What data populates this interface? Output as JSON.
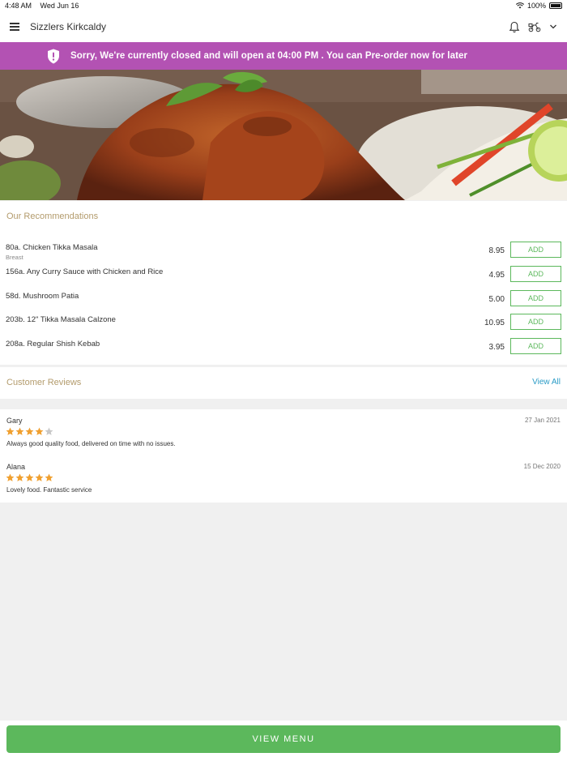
{
  "status_bar": {
    "time": "4:48 AM",
    "date": "Wed Jun 16",
    "battery": "100%"
  },
  "header": {
    "store_name": "Sizzlers Kirkcaldy"
  },
  "banner": {
    "text": "Sorry, We're currently closed and will open at 04:00 PM . You can Pre-order now for later",
    "color": "#b352b3"
  },
  "hero": {
    "icon": "chicken-tikka-photo"
  },
  "recommendations": {
    "title": "Our Recommendations",
    "items": [
      {
        "name": "80a. Chicken Tikka Masala",
        "sub": "Breast",
        "price": "8.95",
        "button": "ADD"
      },
      {
        "name": "156a. Any Curry Sauce with Chicken and Rice",
        "sub": "",
        "price": "4.95",
        "button": "ADD"
      },
      {
        "name": "58d. Mushroom Patia",
        "sub": "",
        "price": "5.00",
        "button": "ADD"
      },
      {
        "name": "203b. 12\" Tikka Masala Calzone",
        "sub": "",
        "price": "10.95",
        "button": "ADD"
      },
      {
        "name": "208a. Regular Shish Kebab",
        "sub": "",
        "price": "3.95",
        "button": "ADD"
      }
    ]
  },
  "reviews": {
    "title": "Customer Reviews",
    "view_all": "View All",
    "items": [
      {
        "name": "Gary",
        "date": "27 Jan 2021",
        "rating": 4,
        "text": "Always good quality food, delivered on time with no issues."
      },
      {
        "name": "Alana",
        "date": "15 Dec 2020",
        "rating": 5,
        "text": "Lovely food. Fantastic service"
      }
    ]
  },
  "footer": {
    "button": "VIEW MENU"
  },
  "colors": {
    "accent_green": "#5cb85c",
    "section_title": "#b39b6c",
    "link": "#2a9bc6",
    "star": "#f0a030"
  }
}
